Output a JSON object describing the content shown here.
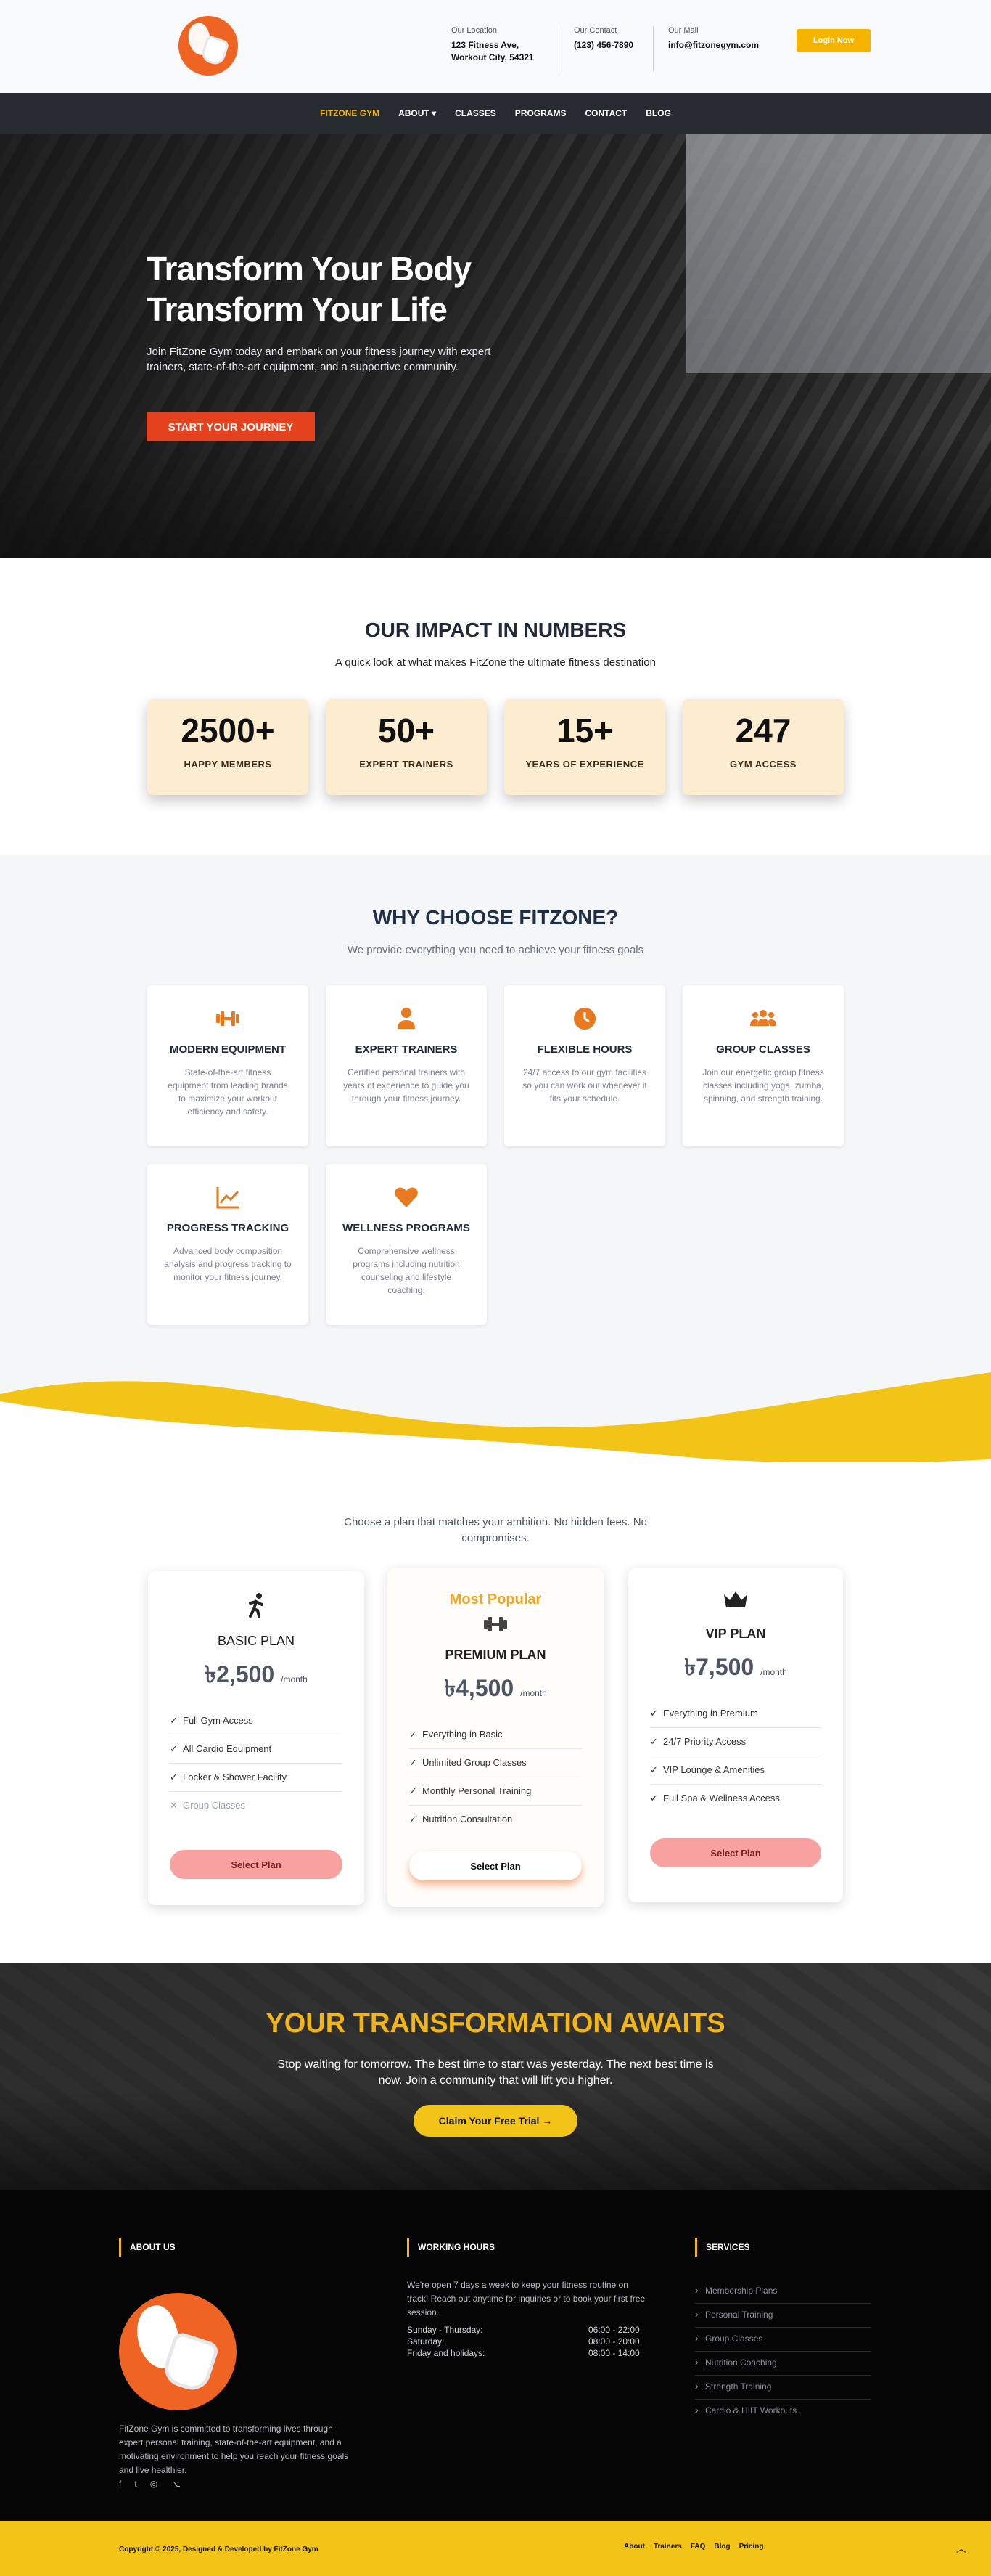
{
  "header": {
    "location": {
      "label": "Our Location",
      "line1": "123 Fitness Ave,",
      "line2": "Workout City, 54321"
    },
    "contact": {
      "label": "Our Contact",
      "value": "(123) 456-7890"
    },
    "mail": {
      "label": "Our Mail",
      "value": "info@fitzonegym.com"
    },
    "login_label": "Login Now"
  },
  "nav": {
    "items": [
      "FITZONE GYM",
      "ABOUT ▾",
      "CLASSES",
      "PROGRAMS",
      "CONTACT",
      "BLOG"
    ]
  },
  "hero": {
    "title_line1": "Transform Your Body",
    "title_line2": "Transform Your Life",
    "text": "Join FitZone Gym today and embark on your fitness journey with expert trainers, state-of-the-art equipment, and a supportive community.",
    "cta": "START YOUR JOURNEY"
  },
  "impact": {
    "title": "OUR IMPACT IN NUMBERS",
    "subtitle": "A quick look at what makes FitZone the ultimate fitness destination",
    "stats": [
      {
        "value": "2500+",
        "label": "HAPPY MEMBERS"
      },
      {
        "value": "50+",
        "label": "EXPERT TRAINERS"
      },
      {
        "value": "15+",
        "label": "YEARS OF EXPERIENCE"
      },
      {
        "value": "247",
        "label": "GYM ACCESS"
      }
    ]
  },
  "why": {
    "title": "WHY CHOOSE FITZONE?",
    "subtitle": "We provide everything you need to achieve your fitness goals",
    "features": [
      {
        "icon": "dumbbell-icon",
        "title": "MODERN EQUIPMENT",
        "text": "State-of-the-art fitness equipment from leading brands to maximize your workout efficiency and safety."
      },
      {
        "icon": "trainer-icon",
        "title": "EXPERT TRAINERS",
        "text": "Certified personal trainers with years of experience to guide you through your fitness journey."
      },
      {
        "icon": "clock-icon",
        "title": "FLEXIBLE HOURS",
        "text": "24/7 access to our gym facilities so you can work out whenever it fits your schedule."
      },
      {
        "icon": "group-icon",
        "title": "GROUP CLASSES",
        "text": "Join our energetic group fitness classes including yoga, zumba, spinning, and strength training."
      },
      {
        "icon": "chart-line-icon",
        "title": "PROGRESS TRACKING",
        "text": "Advanced body composition analysis and progress tracking to monitor your fitness journey."
      },
      {
        "icon": "heart-icon",
        "title": "WELLNESS PROGRAMS",
        "text": "Comprehensive wellness programs including nutrition counseling and lifestyle coaching."
      }
    ]
  },
  "plans": {
    "subtitle": "Choose a plan that matches your ambition. No hidden fees. No compromises.",
    "basic": {
      "name": "BASIC PLAN",
      "price": "৳2,500",
      "period": "/month",
      "button": "Select Plan",
      "features": [
        "Full Gym Access",
        "All Cardio Equipment",
        "Locker & Shower Facility",
        "Group Classes"
      ]
    },
    "premium": {
      "badge": "Most Popular",
      "name": "PREMIUM PLAN",
      "price": "৳4,500",
      "period": "/month",
      "button": "Select Plan",
      "features": [
        "Everything in Basic",
        "Unlimited Group Classes",
        "Monthly Personal Training",
        "Nutrition Consultation"
      ]
    },
    "vip": {
      "name": "VIP PLAN",
      "price": "৳7,500",
      "period": "/month",
      "button": "Select Plan",
      "features": [
        "Everything in Premium",
        "24/7 Priority Access",
        "VIP Lounge & Amenities",
        "Full Spa & Wellness Access"
      ]
    }
  },
  "transformation": {
    "title": "YOUR TRANSFORMATION AWAITS",
    "text": "Stop waiting for tomorrow. The best time to start was yesterday. The next best time is now. Join a community that will lift you higher.",
    "cta": "Claim Your Free Trial →"
  },
  "footer": {
    "about_title": "ABOUT US",
    "about_text": "FitZone Gym is committed to transforming lives through expert personal training, state-of-the-art equipment, and a motivating environment to help you reach your fitness goals and live healthier.",
    "hours_title": "WORKING HOURS",
    "hours_text": "We're open 7 days a week to keep your fitness routine on track! Reach out anytime for inquiries or to book your first free session.",
    "hours": [
      {
        "day": "Sunday - Thursday:",
        "time": "06:00 - 22:00"
      },
      {
        "day": "Saturday:",
        "time": "08:00 - 20:00"
      },
      {
        "day": "Friday and holidays:",
        "time": "08:00 - 14:00"
      }
    ],
    "services_title": "SERVICES",
    "services": [
      "Membership Plans",
      "Personal Training",
      "Group Classes",
      "Nutrition Coaching",
      "Strength Training",
      "Cardio & HIIT Workouts"
    ],
    "social": [
      "f",
      "t",
      "◎",
      "⌥"
    ]
  },
  "bottom": {
    "copyright": "Copyright © 2025, Designed & Developed by FitZone Gym",
    "links": [
      "About",
      "Trainers",
      "FAQ",
      "Blog",
      "Pricing"
    ],
    "scroll_up": "︿"
  }
}
